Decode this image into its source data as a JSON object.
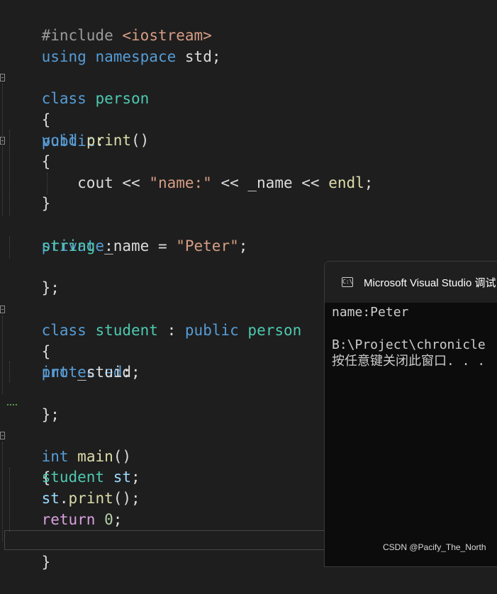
{
  "code": {
    "l1_pp": "#include",
    "l1_hdr": "<iostream>",
    "l2_using": "using",
    "l2_ns": "namespace",
    "l2_std": "std;",
    "l4_class": "class",
    "l4_name": "person",
    "l5": "{",
    "l6_public": "public",
    "l6_colon": ":",
    "l7_void": "void",
    "l7_fn": "print",
    "l7_paren": "()",
    "l8": "{",
    "l9_cout": "cout << ",
    "l9_str": "\"name:\"",
    "l9_mid": " << _name << ",
    "l9_endl": "endl",
    "l9_semi": ";",
    "l10": "}",
    "l11_private": "private",
    "l11_colon": ":",
    "l12_type": "string",
    "l12_mid": " _name = ",
    "l12_str": "\"Peter\"",
    "l12_semi": ";",
    "l13": "};",
    "l15_class": "class",
    "l15_name": "student",
    "l15_colon": " : ",
    "l15_public": "public",
    "l15_base": "person",
    "l16": "{",
    "l17_protected": "protected",
    "l17_colon": ":",
    "l18_int": "int",
    "l18_rest": " _stuid;",
    "l19": "};",
    "l21_int": "int",
    "l21_main": "main",
    "l21_paren": "()",
    "l22": "{",
    "l23_type": "student",
    "l23_var": "st",
    "l23_semi": ";",
    "l24_var": "st",
    "l24_dot": ".",
    "l24_fn": "print",
    "l24_rest": "();",
    "l25_ret": "return",
    "l25_num": "0",
    "l25_semi": ";",
    "l26": "}"
  },
  "console": {
    "icon": "console-app-icon",
    "icon_glyph": "C:\\",
    "title": "Microsoft Visual Studio 调试",
    "output_line1": "name:Peter",
    "output_line2": "",
    "output_line3": "B:\\Project\\chronicle",
    "output_line4": "按任意键关闭此窗口. . ."
  },
  "watermark": "CSDN @Pacify_The_North",
  "colors": {
    "background": "#1e1e1e",
    "keyword": "#569cd6",
    "type": "#4ec9b0",
    "function": "#dcdcaa",
    "string": "#d69d85",
    "control": "#d8a0df",
    "console_bg": "#0c0c0c"
  }
}
